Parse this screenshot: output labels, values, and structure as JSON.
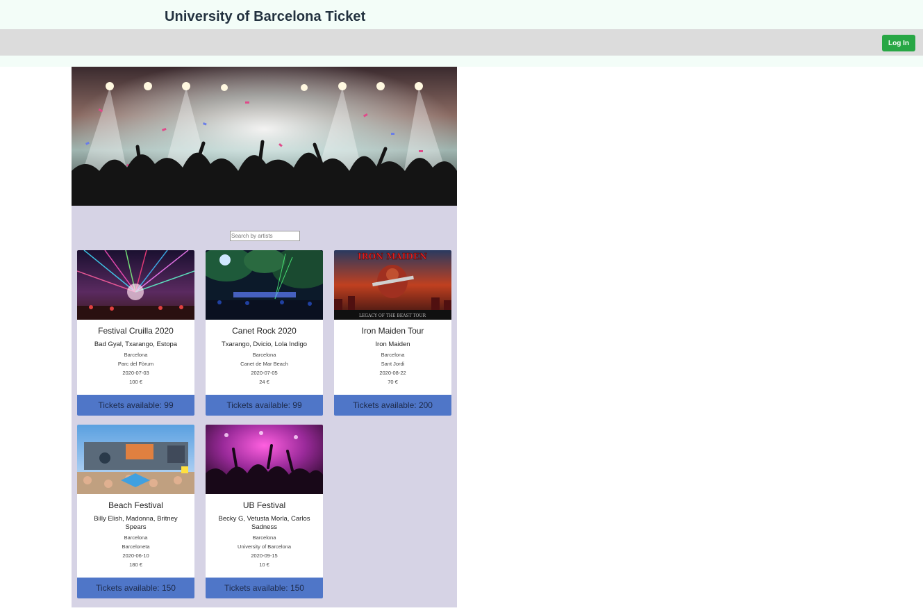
{
  "header": {
    "title": "University of Barcelona Ticket"
  },
  "nav": {
    "login_label": "Log In",
    "login_color": "#28a745"
  },
  "search": {
    "placeholder": "Search by artists",
    "value": ""
  },
  "colors": {
    "panel": "#d6d3e5",
    "tickets_bar": "#4f76c8",
    "navbar": "#dcdcdc",
    "header_bg": "#f3fdf8"
  },
  "events": [
    {
      "name": "Festival Cruilla 2020",
      "artists": "Bad Gyal, Txarango, Estopa",
      "city": "Barcelona",
      "venue": "Parc del Fòrum",
      "date": "2020-07-03",
      "price": "100 €",
      "tickets": "Tickets available: 99",
      "image": "festival-lights"
    },
    {
      "name": "Canet Rock 2020",
      "artists": "Txarango, Dvicio, Lola Indigo",
      "city": "Barcelona",
      "venue": "Canet de Mar Beach",
      "date": "2020-07-05",
      "price": "24 €",
      "tickets": "Tickets available: 99",
      "image": "forest-stage"
    },
    {
      "name": "Iron Maiden Tour",
      "artists": "Iron Maiden",
      "city": "Barcelona",
      "venue": "Sant Jordi",
      "date": "2020-08-22",
      "price": "70 €",
      "tickets": "Tickets available: 200",
      "image": "iron-maiden-poster",
      "poster_text": "IRON MAIDEN",
      "poster_subtext": "LEGACY OF THE BEAST TOUR"
    },
    {
      "name": "Beach Festival",
      "artists": "Billy Elish, Madonna, Britney Spears",
      "city": "Barcelona",
      "venue": "Barceloneta",
      "date": "2020-06-10",
      "price": "180 €",
      "tickets": "Tickets available: 150",
      "image": "beach-stage"
    },
    {
      "name": "UB Festival",
      "artists": "Becky G, Vetusta Morla, Carlos Sadness",
      "city": "Barcelona",
      "venue": "University of Barcelona",
      "date": "2020-09-15",
      "price": "10 €",
      "tickets": "Tickets available: 150",
      "image": "purple-crowd"
    }
  ]
}
